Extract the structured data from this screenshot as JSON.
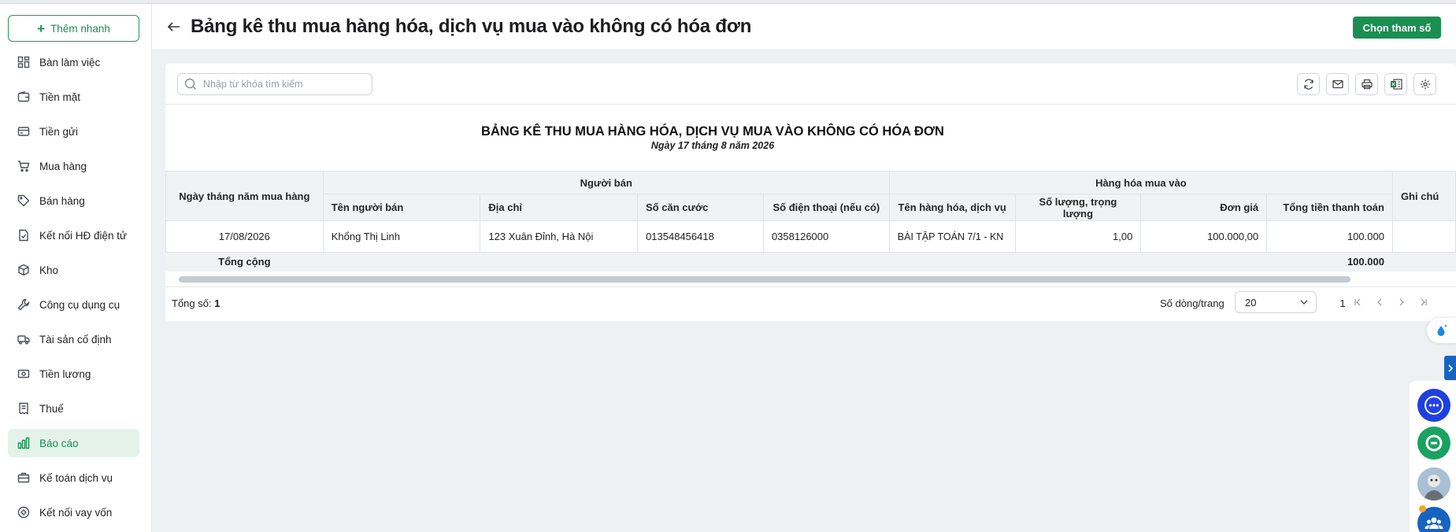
{
  "sidebar": {
    "quick_add": "Thêm nhanh",
    "items": [
      {
        "label": "Bàn làm việc",
        "icon": "dashboard-icon"
      },
      {
        "label": "Tiền mặt",
        "icon": "wallet-icon"
      },
      {
        "label": "Tiền gửi",
        "icon": "card-icon"
      },
      {
        "label": "Mua hàng",
        "icon": "cart-icon"
      },
      {
        "label": "Bán hàng",
        "icon": "tag-icon"
      },
      {
        "label": "Kết nối HĐ điện tử",
        "icon": "invoice-icon"
      },
      {
        "label": "Kho",
        "icon": "box-icon"
      },
      {
        "label": "Công cụ dụng cụ",
        "icon": "wrench-icon"
      },
      {
        "label": "Tài sản cố định",
        "icon": "truck-icon"
      },
      {
        "label": "Tiền lương",
        "icon": "money-icon"
      },
      {
        "label": "Thuế",
        "icon": "receipt-icon"
      },
      {
        "label": "Báo cáo",
        "icon": "chart-icon",
        "active": true
      },
      {
        "label": "Kế toán dịch vụ",
        "icon": "briefcase-icon"
      },
      {
        "label": "Kết nối vay vốn",
        "icon": "link-icon"
      }
    ]
  },
  "header": {
    "title": "Bảng kê thu mua hàng hóa, dịch vụ mua vào không có hóa đơn",
    "choose_params": "Chọn tham số"
  },
  "search": {
    "placeholder": "Nhập từ khóa tìm kiếm"
  },
  "report": {
    "title": "BẢNG KÊ THU MUA HÀNG HÓA, DỊCH VỤ MUA VÀO KHÔNG CÓ HÓA ĐƠN",
    "date": "Ngày 17 tháng 8 năm 2026",
    "headers": {
      "purchase_date": "Ngày tháng năm mua hàng",
      "seller_group": "Người bán",
      "goods_group": "Hàng hóa mua vào",
      "note": "Ghi chú",
      "seller_name": "Tên người bán",
      "address": "Địa chỉ",
      "id_card": "Số căn cước",
      "phone": "Số điện thoại (nếu có)",
      "goods_name": "Tên hàng hóa, dịch vụ",
      "quantity": "Số lượng, trọng lượng",
      "unit_price": "Đơn giá",
      "total_amount": "Tổng tiền thanh toán"
    },
    "rows": [
      {
        "purchase_date": "17/08/2026",
        "seller_name": "Khổng Thị Linh",
        "address": "123 Xuân Đỉnh, Hà Nội",
        "id_card": "013548456418",
        "phone": "0358126000",
        "goods_name": "BÀI TẬP TOÁN 7/1 - KN",
        "quantity": "1,00",
        "unit_price": "100.000,00",
        "total_amount": "100.000",
        "note": ""
      }
    ],
    "total_label": "Tổng cộng",
    "total_amount": "100.000"
  },
  "footer": {
    "total_label": "Tổng số:",
    "total_value": "1",
    "per_page_label": "Số dòng/trang",
    "per_page_value": "20",
    "page": "1"
  },
  "colors": {
    "accent": "#1a8f52",
    "active_bg": "#e4f2ea",
    "side_tab": "#1565c0"
  }
}
